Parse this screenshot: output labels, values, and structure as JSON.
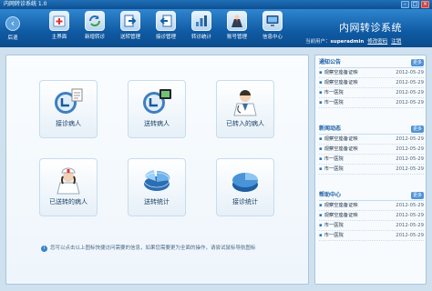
{
  "window": {
    "title": "内网转诊系统 1.0",
    "controls": [
      "–",
      "□",
      "×"
    ]
  },
  "toolbar": {
    "back_label": "后退",
    "items": [
      {
        "label": "主界面",
        "icon": "hospital-cross-icon"
      },
      {
        "label": "新增转诊",
        "icon": "refresh-arrows-icon"
      },
      {
        "label": "送转管理",
        "icon": "arrow-out-icon"
      },
      {
        "label": "接诊管理",
        "icon": "arrow-in-icon"
      },
      {
        "label": "转诊统计",
        "icon": "bar-chart-icon"
      },
      {
        "label": "账号管理",
        "icon": "user-suit-icon"
      },
      {
        "label": "信息中心",
        "icon": "monitor-icon"
      }
    ]
  },
  "app": {
    "system_title": "内网转诊系统",
    "user_prefix": "当前用户：",
    "username": "superadmin",
    "links": [
      "修改密码",
      "注销"
    ]
  },
  "main": {
    "tiles": [
      {
        "label": "接诊病人"
      },
      {
        "label": "送转病人"
      },
      {
        "label": "已转入的病人"
      },
      {
        "label": "已送转的病人"
      },
      {
        "label": "送转统计"
      },
      {
        "label": "接诊统计"
      }
    ],
    "tip": "您可以点击以上图标快捷访问需要的信息，如果您需要更为全面的操作，请尝试鼠标导航图标"
  },
  "side": {
    "more_label": "更多",
    "sections": [
      {
        "title": "通知公告",
        "items": [
          {
            "text": "观察空座备证映",
            "date": "2012-05-29"
          },
          {
            "text": "观察空座备证映",
            "date": "2012-05-29"
          },
          {
            "text": "市一医院",
            "date": "2012-05-29"
          },
          {
            "text": "市一医院",
            "date": "2012-05-29"
          }
        ]
      },
      {
        "title": "新闻动态",
        "items": [
          {
            "text": "观察空座备证映",
            "date": "2012-05-29"
          },
          {
            "text": "观察空座备证映",
            "date": "2012-05-29"
          },
          {
            "text": "市一医院",
            "date": "2012-05-29"
          },
          {
            "text": "市一医院",
            "date": "2012-05-29"
          }
        ]
      },
      {
        "title": "帮助中心",
        "items": [
          {
            "text": "观察空座备证映",
            "date": "2012-05-29"
          },
          {
            "text": "观察空座备证映",
            "date": "2012-05-29"
          },
          {
            "text": "市一医院",
            "date": "2012-05-29"
          },
          {
            "text": "市一医院",
            "date": "2012-05-29"
          }
        ]
      }
    ]
  },
  "colors": {
    "toolbar": "#0f5aa3",
    "accent": "#2d73b9",
    "more_button": "#4f93d6"
  }
}
